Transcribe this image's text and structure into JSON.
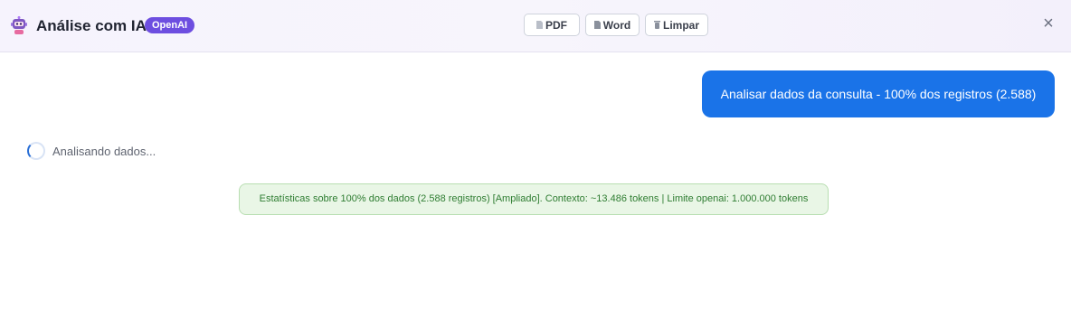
{
  "header": {
    "icon": "robot-icon",
    "title": "Análise com IA",
    "badge": "OpenAI",
    "buttons": {
      "pdf": {
        "label": "PDF",
        "icon": "document-icon"
      },
      "word": {
        "label": "Word",
        "icon": "document-icon"
      },
      "clear": {
        "label": "Limpar",
        "icon": "trash-icon"
      }
    },
    "close": "×"
  },
  "chat": {
    "user_message": "Analisar dados da consulta - 100% dos registros (2.588)",
    "loading_text": "Analisando dados...",
    "stats_text": "Estatísticas sobre 100% dos dados (2.588 registros) [Ampliado]. Contexto: ~13.486 tokens | Limite openai: 1.000.000 tokens"
  },
  "colors": {
    "brand": "#6d4ee0",
    "user_bubble": "#1a73e8",
    "stats_bg": "#e9f6e6",
    "stats_text": "#2f7d32"
  }
}
